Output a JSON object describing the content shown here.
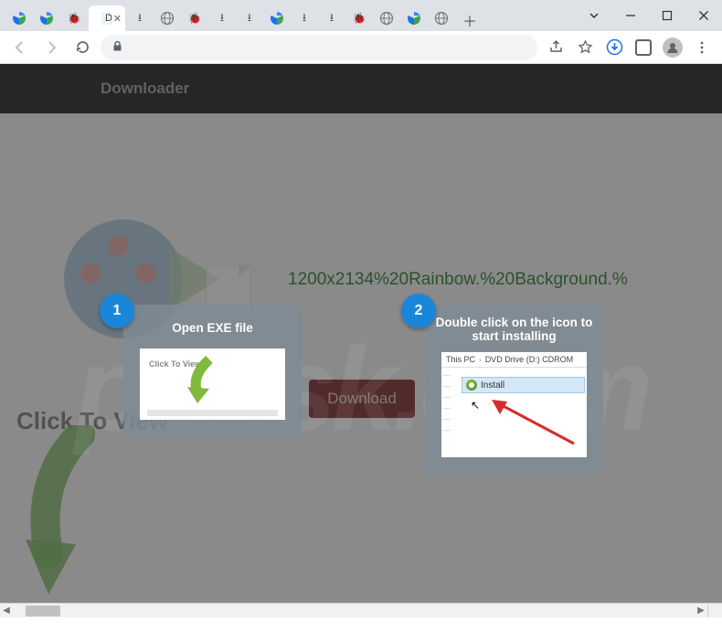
{
  "titlebar": {
    "active_tab_label": "D",
    "tab_icons": [
      "recaptcha",
      "recaptcha",
      "bug",
      "doc",
      "download",
      "globe",
      "bug",
      "download",
      "download",
      "recaptcha",
      "download",
      "download",
      "bug",
      "globe",
      "recaptcha",
      "globe"
    ]
  },
  "header": {
    "title": "Downloader"
  },
  "page": {
    "filename": "1200x2134%20Rainbow.%20Background.%",
    "download_label": "Download",
    "click_to_view": "Click To View"
  },
  "card1": {
    "badge": "1",
    "title": "Open EXE file",
    "inner_text": "Click To View"
  },
  "card2": {
    "badge": "2",
    "title": "Double click on the icon to start installing",
    "breadcrumb": {
      "root": "This PC",
      "drive": "DVD Drive (D:) CDROM"
    },
    "install_label": "Install"
  },
  "watermark": "pcrisk.com"
}
